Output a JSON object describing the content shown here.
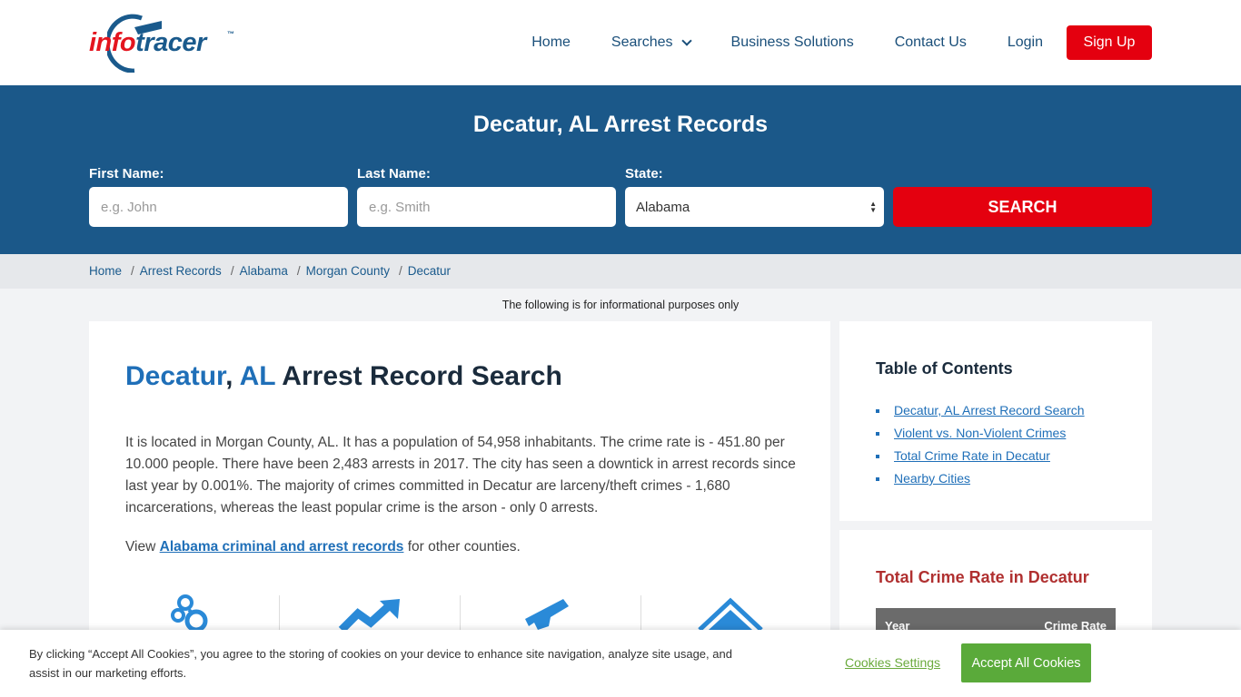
{
  "header": {
    "logo": {
      "part1": "info",
      "part2": "tracer",
      "tm": "™"
    },
    "nav": [
      {
        "label": "Home"
      },
      {
        "label": "Searches"
      },
      {
        "label": "Business Solutions"
      },
      {
        "label": "Contact Us"
      },
      {
        "label": "Login"
      }
    ],
    "signup_label": "Sign Up"
  },
  "hero": {
    "title": "Decatur, AL Arrest Records",
    "first_name_label": "First Name:",
    "first_name_placeholder": "e.g. John",
    "last_name_label": "Last Name:",
    "last_name_placeholder": "e.g. Smith",
    "state_label": "State:",
    "state_value": "Alabama",
    "search_label": "SEARCH"
  },
  "breadcrumb": [
    "Home",
    "Arrest Records",
    "Alabama",
    "Morgan County",
    "Decatur"
  ],
  "disclaimer": "The following is for informational purposes only",
  "main": {
    "title_city": "Decatur",
    "title_comma": ", ",
    "title_state": "AL",
    "title_rest": " Arrest Record Search",
    "paragraph": "It is located in Morgan County, AL. It has a population of 54,958 inhabitants. The crime rate is - 451.80 per 10.000 people. There have been 2,483 arrests in 2017. The city has seen a downtick in arrest records since last year by 0.001%. The majority of crimes committed in Decatur are larceny/theft crimes - 1,680 incarcerations, whereas the least popular crime is the arson - only 0 arrests.",
    "view_prefix": "View ",
    "view_link": "Alabama criminal and arrest records",
    "view_suffix": " for other counties.",
    "icons": [
      "handcuffs-icon",
      "trend-up-icon",
      "gun-icon",
      "house-icon"
    ]
  },
  "toc": {
    "title": "Table of Contents",
    "items": [
      "Decatur, AL Arrest Record Search",
      "Violent vs. Non-Violent Crimes",
      "Total Crime Rate in Decatur",
      "Nearby Cities"
    ]
  },
  "rate": {
    "title": "Total Crime Rate in Decatur",
    "col_year": "Year",
    "col_rate": "Crime Rate"
  },
  "cookie": {
    "text": "By clicking “Accept All Cookies”, you agree to the storing of cookies on your device to enhance site navigation, analyze site usage, and assist in our marketing efforts.",
    "settings_label": "Cookies Settings",
    "accept_label": "Accept All Cookies"
  },
  "colors": {
    "brand_blue": "#1b5889",
    "accent_red": "#e4000f",
    "link_blue": "#1f6fb8",
    "cookie_green": "#5aaa3a"
  }
}
